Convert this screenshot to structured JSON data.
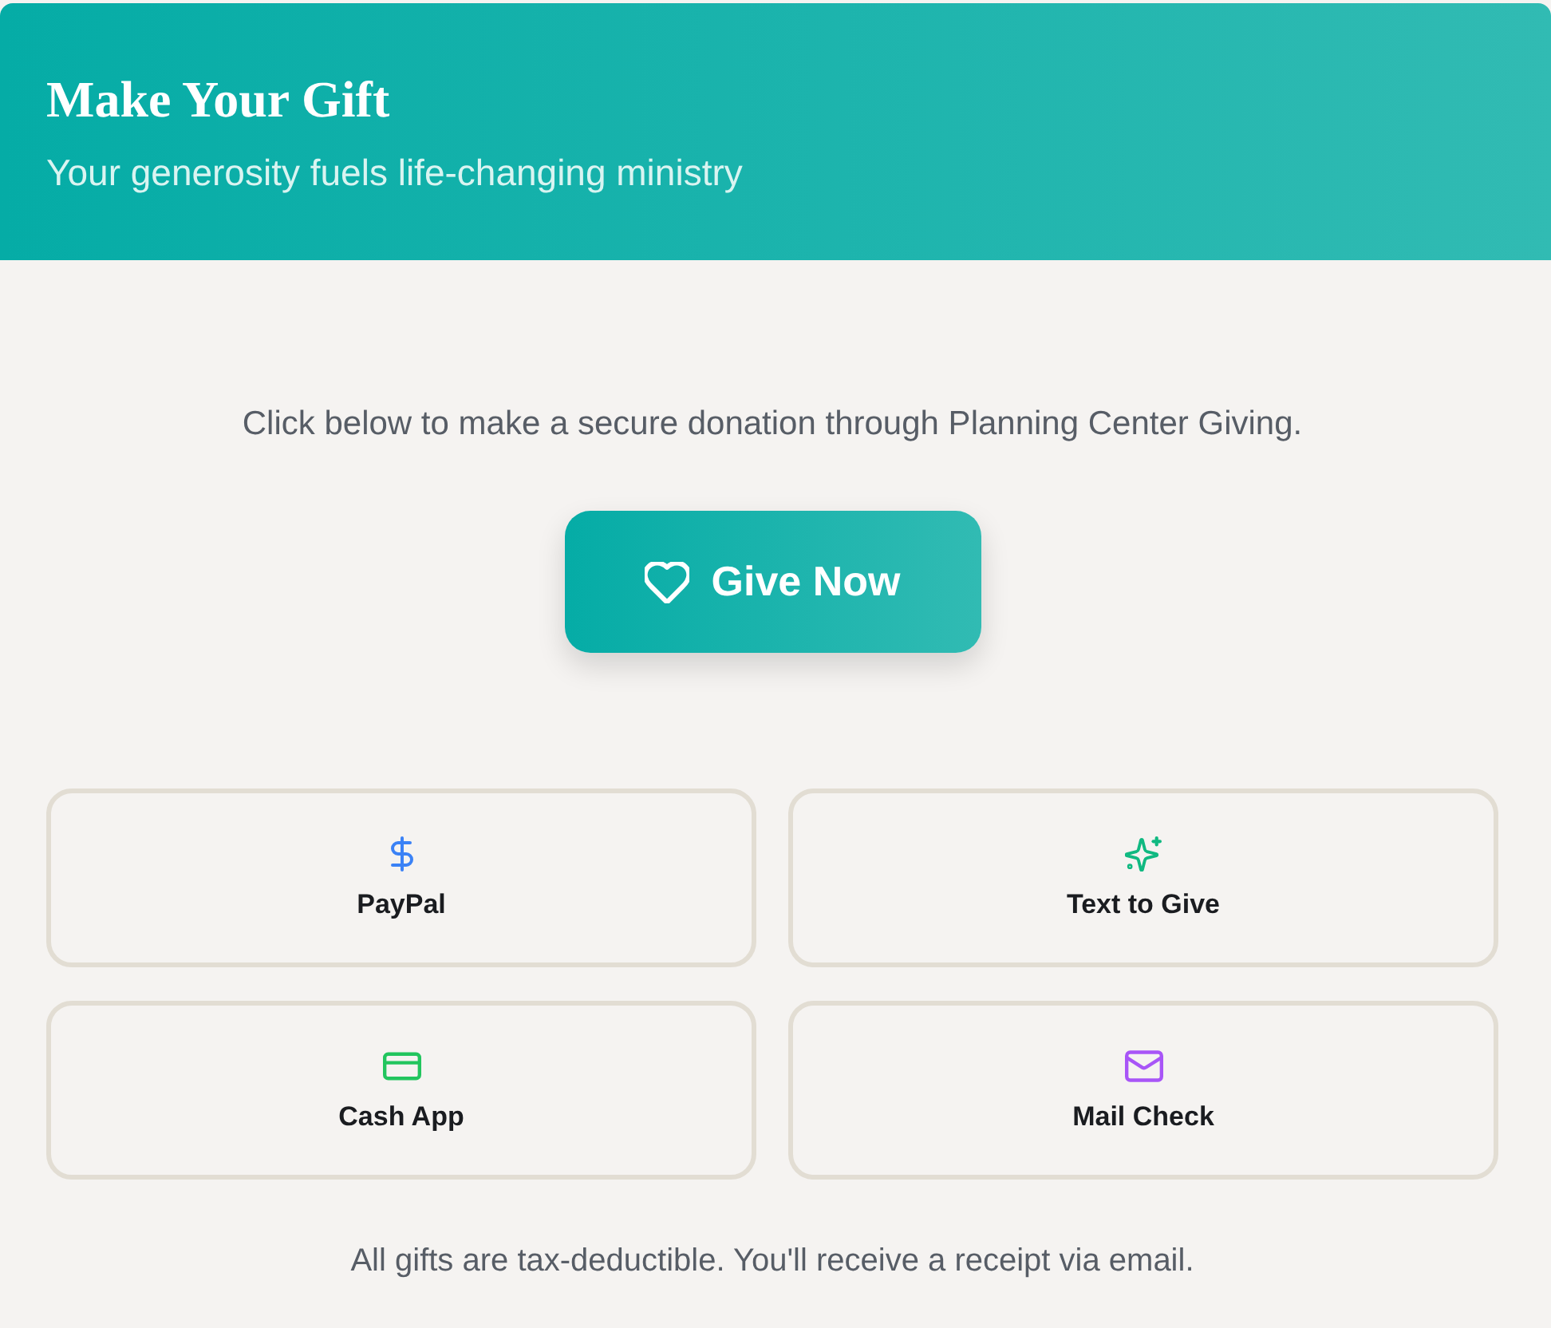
{
  "header": {
    "title": "Make Your Gift",
    "subtitle": "Your generosity fuels life-changing ministry"
  },
  "intro": "Click below to make a secure donation through Planning Center Giving.",
  "give_button": {
    "label": "Give Now"
  },
  "options": [
    {
      "label": "PayPal",
      "color": "#3b82f6"
    },
    {
      "label": "Text to Give",
      "color": "#10b981"
    },
    {
      "label": "Cash App",
      "color": "#22c55e"
    },
    {
      "label": "Mail Check",
      "color": "#a855f7"
    }
  ],
  "footer_note": "All gifts are tax-deductible. You'll receive a receipt via email."
}
